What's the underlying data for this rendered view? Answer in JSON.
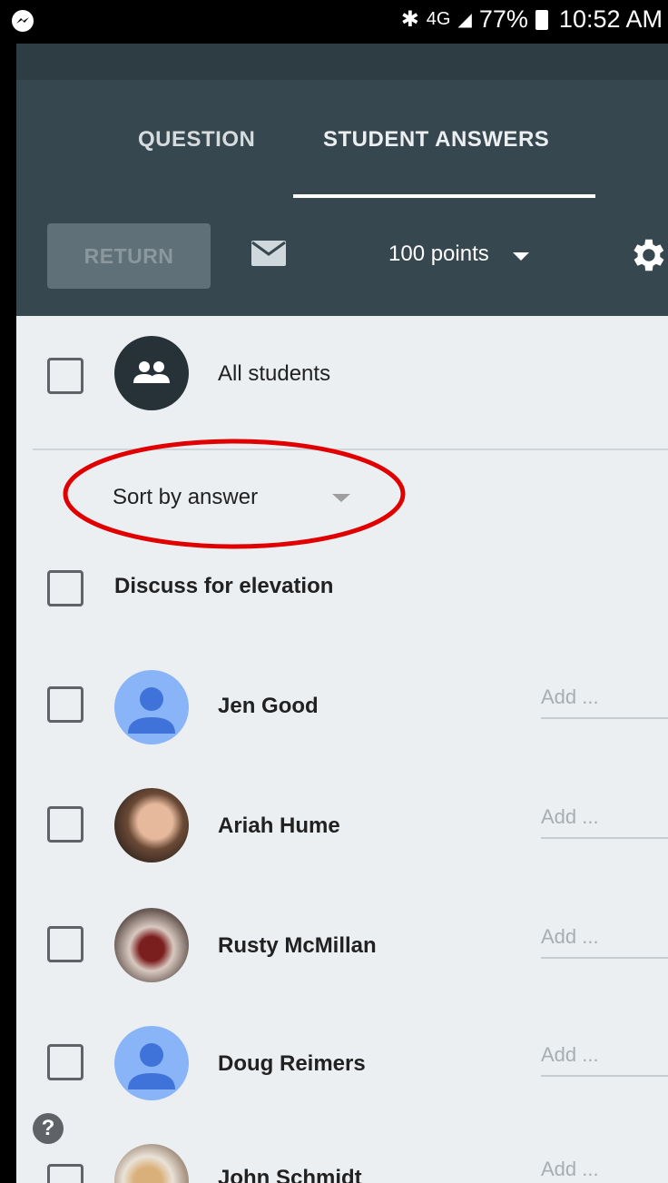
{
  "status_bar": {
    "battery": "77%",
    "time": "10:52 AM",
    "network": "4G",
    "icons": [
      "messenger-icon",
      "bluetooth-icon",
      "4g-icon",
      "signal-icon",
      "battery-icon"
    ]
  },
  "tabs": [
    {
      "label": "QUESTION",
      "active": false
    },
    {
      "label": "STUDENT ANSWERS",
      "active": true
    }
  ],
  "toolbar": {
    "return_label": "RETURN",
    "points_label": "100 points",
    "icons": [
      "mail-icon",
      "caret-down-icon",
      "gear-icon"
    ]
  },
  "all_students": {
    "label": "All students",
    "icon": "group-icon"
  },
  "sort": {
    "label": "Sort by answer"
  },
  "answer_group": {
    "label": "Discuss for elevation"
  },
  "students": [
    {
      "name": "Jen Good",
      "avatar": "default-person",
      "grade_placeholder": "Add ..."
    },
    {
      "name": "Ariah Hume",
      "avatar": "photo",
      "grade_placeholder": "Add ..."
    },
    {
      "name": "Rusty McMillan",
      "avatar": "photo",
      "grade_placeholder": "Add ..."
    },
    {
      "name": "Doug Reimers",
      "avatar": "default-person",
      "grade_placeholder": "Add ..."
    },
    {
      "name": "John Schmidt",
      "avatar": "photo",
      "grade_placeholder": "Add ..."
    }
  ],
  "help": {
    "label": "?"
  },
  "colors": {
    "appbar": "#37474f",
    "background": "#eceff1",
    "highlight": "#e00000",
    "default_avatar": "#8ab4f8",
    "default_avatar_figure": "#3f73d9"
  }
}
